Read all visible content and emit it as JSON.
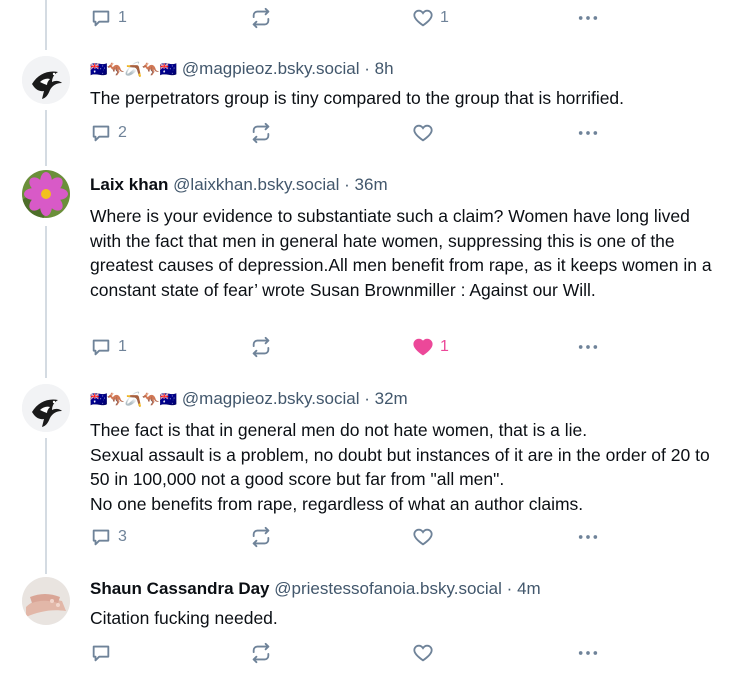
{
  "top_actions": {
    "reply_count": "1",
    "like_count": "1"
  },
  "posts": [
    {
      "display_name": "🇦🇺🦘🪃🦘🇦🇺",
      "handle": "@magpieoz.bsky.social",
      "time": "8h",
      "text": "The perpetrators group is tiny compared to the group that is horrified.",
      "reply_count": "2",
      "like_count": ""
    },
    {
      "display_name": "Laix khan",
      "handle": "@laixkhan.bsky.social",
      "time": "36m",
      "text": "Where is your evidence to substantiate such a claim? Women have long lived with the fact that men in general hate women, suppressing this is one of the greatest causes of depression.All men benefit from rape, as it keeps women in a constant state of fear’ wrote Susan Brownmiller : Against our Will.",
      "reply_count": "1",
      "like_count": "1"
    },
    {
      "display_name": "🇦🇺🦘🪃🦘🇦🇺",
      "handle": "@magpieoz.bsky.social",
      "time": "32m",
      "text": "Thee fact is that in general men do not hate women, that is a lie.\nSexual assault is a problem, no doubt but instances of it are in the order of 20 to 50 in 100,000 not a good score but far from \"all men\".\nNo one benefits from rape, regardless of what an author claims.",
      "reply_count": "3",
      "like_count": ""
    },
    {
      "display_name": "Shaun Cassandra Day",
      "handle": "@priestessofanoia.bsky.social",
      "time": "4m",
      "text": "Citation fucking needed.",
      "reply_count": "",
      "like_count": ""
    }
  ],
  "separator": "·",
  "colors": {
    "like_active": "#ec4899",
    "muted": "#6f8399",
    "thread_line": "#d4dbe2"
  }
}
